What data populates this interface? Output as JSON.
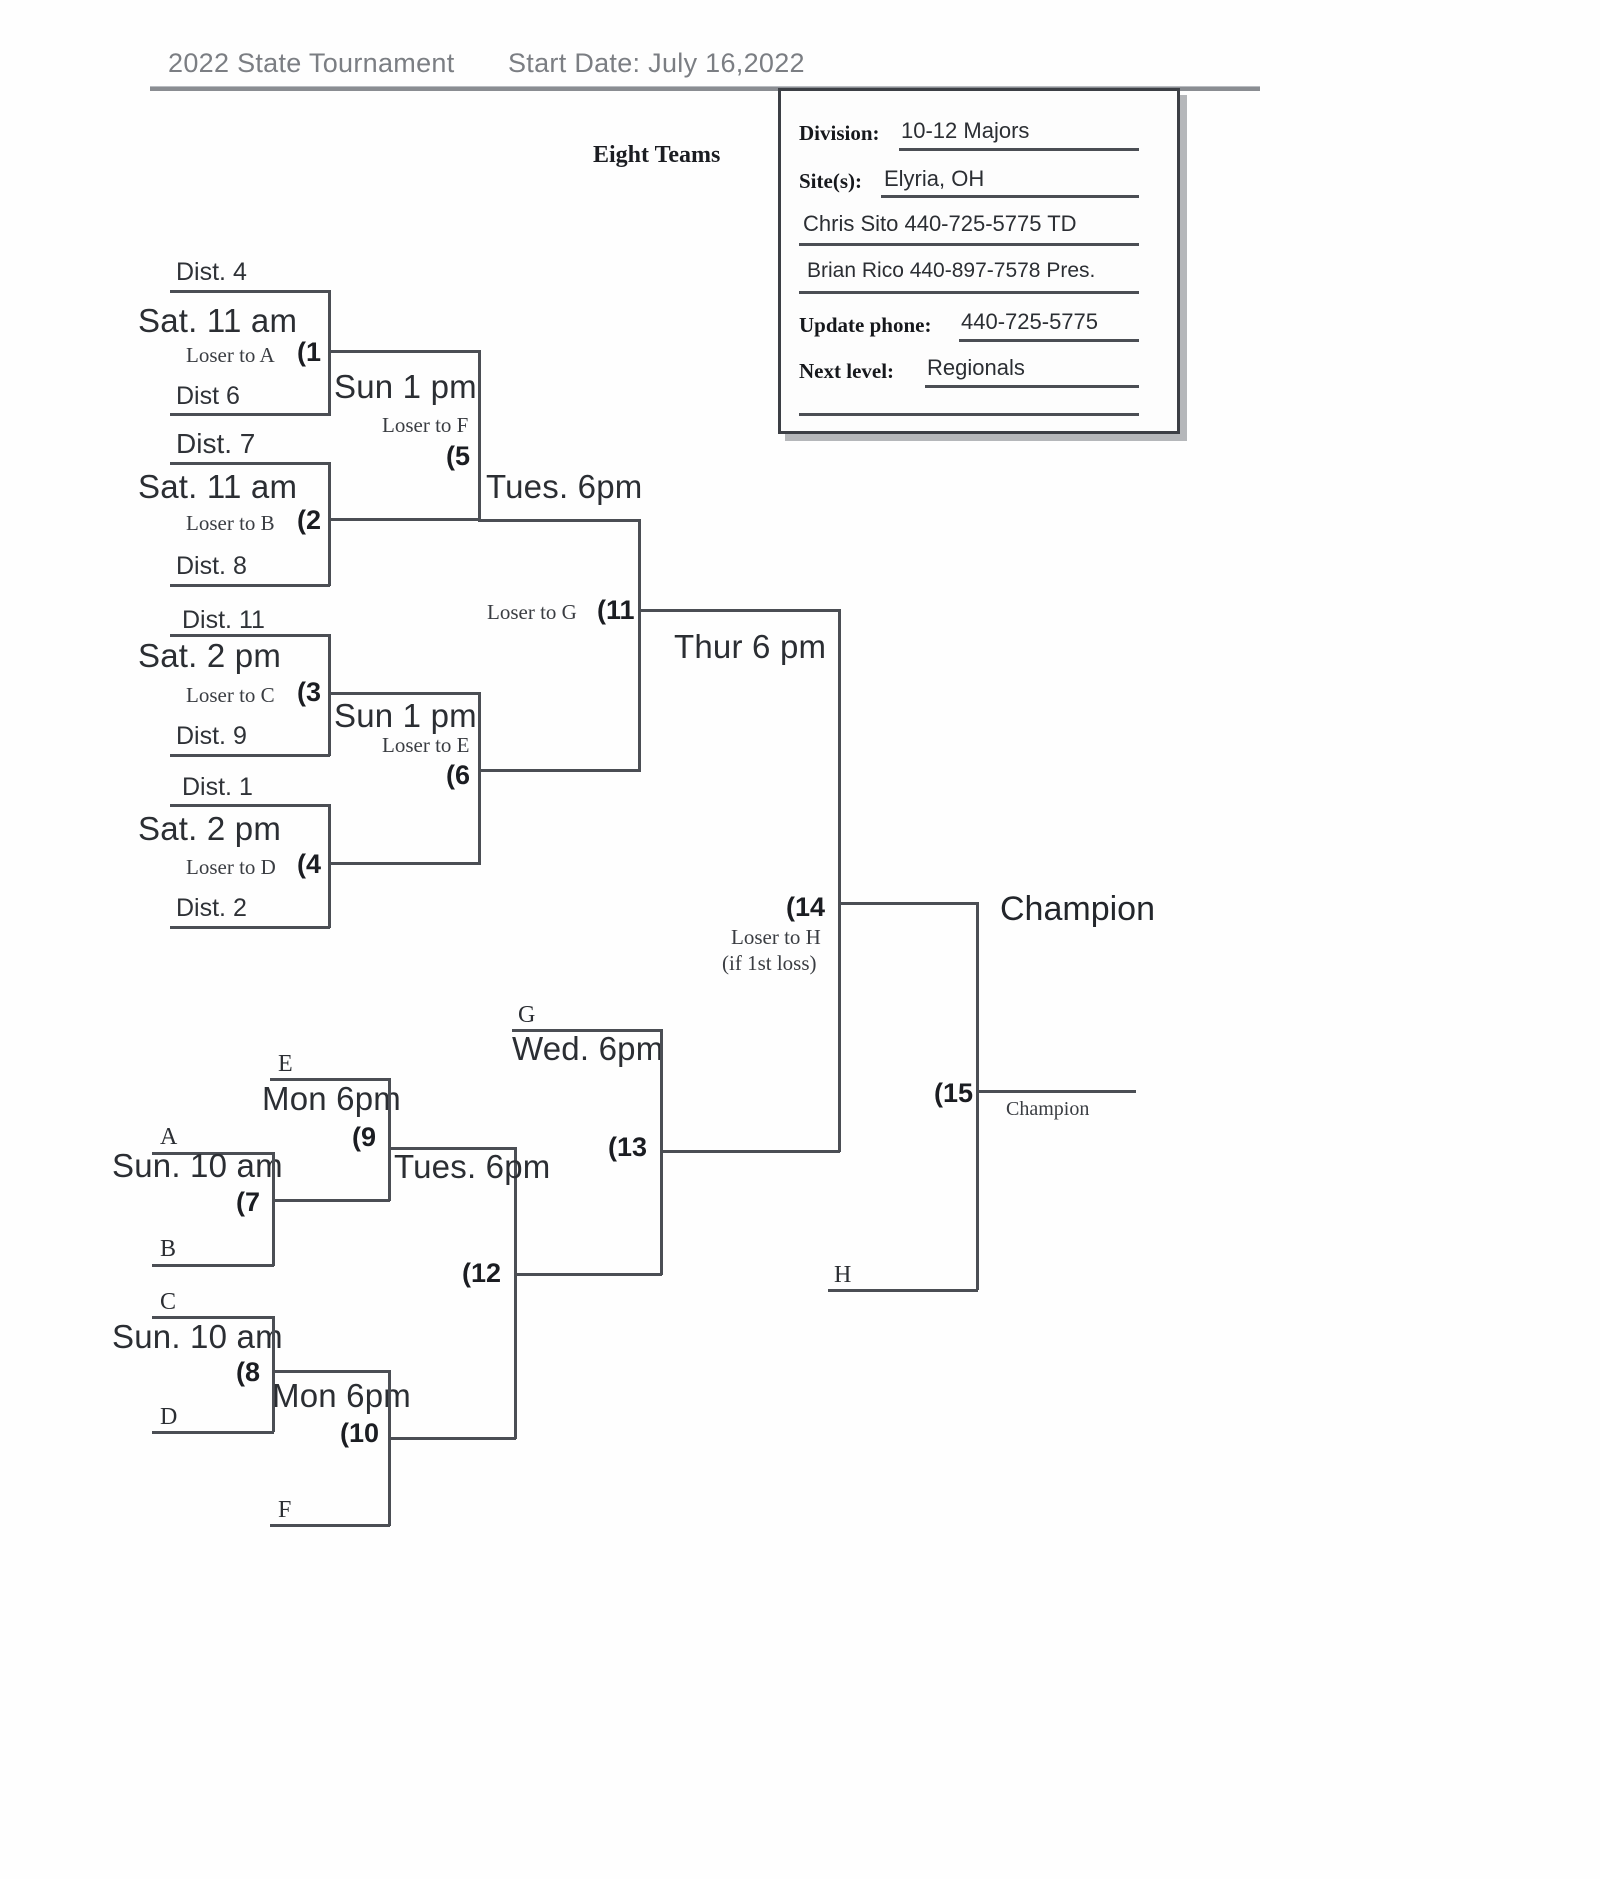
{
  "header": {
    "title": "2022 State Tournament",
    "start_date": "Start Date: July 16,2022",
    "eight_teams": "Eight Teams"
  },
  "infobox": {
    "division_label": "Division:",
    "division_value": "10-12 Majors",
    "sites_label": "Site(s):",
    "sites_value": "Elyria, OH",
    "contact1": "Chris Sito 440-725-5775 TD",
    "contact2": "Brian Rico 440-897-7578 Pres.",
    "update_phone_label": "Update phone:",
    "update_phone_value": "440-725-5775",
    "next_level_label": "Next level:",
    "next_level_value": "Regionals"
  },
  "winners_bracket": {
    "game1": {
      "top_team": "Dist. 4",
      "bottom_team": "Dist 6",
      "time": "Sat. 11 am",
      "loser_to": "Loser to A",
      "number": "(1"
    },
    "game2": {
      "top_team": "Dist. 7",
      "bottom_team": "Dist. 8",
      "time": "Sat. 11 am",
      "loser_to": "Loser to B",
      "number": "(2"
    },
    "game3": {
      "top_team": "Dist. 11",
      "bottom_team": "Dist. 9",
      "time": "Sat. 2 pm",
      "loser_to": "Loser to C",
      "number": "(3"
    },
    "game4": {
      "top_team": "Dist. 1",
      "bottom_team": "Dist. 2",
      "time": "Sat. 2 pm",
      "loser_to": "Loser to D",
      "number": "(4"
    },
    "game5": {
      "time": "Sun 1 pm",
      "loser_to": "Loser to F",
      "number": "(5"
    },
    "game6": {
      "time": "Sun 1 pm",
      "loser_to": "Loser to E",
      "number": "(6"
    },
    "game11": {
      "time": "Tues. 6pm",
      "loser_to": "Loser to G",
      "number": "(11"
    },
    "game14": {
      "time": "Thur 6 pm",
      "loser_to": "Loser to H",
      "loser_to_note": "(if 1st loss)",
      "number": "(14"
    }
  },
  "losers_bracket": {
    "game7": {
      "top_team": "A",
      "bottom_team": "B",
      "time": "Sun. 10 am",
      "number": "(7"
    },
    "game8": {
      "top_team": "C",
      "bottom_team": "D",
      "time": "Sun. 10 am",
      "number": "(8"
    },
    "game9": {
      "top_team": "E",
      "time": "Mon 6pm",
      "number": "(9"
    },
    "game10": {
      "bottom_team": "F",
      "time": "Mon 6pm",
      "number": "(10"
    },
    "game12": {
      "time": "Tues. 6pm",
      "number": "(12"
    },
    "game13": {
      "top_team": "G",
      "time": "Wed. 6pm",
      "number": "(13"
    },
    "game15": {
      "bottom_team": "H",
      "number": "(15"
    }
  },
  "champion": {
    "title": "Champion",
    "caption": "Champion"
  }
}
